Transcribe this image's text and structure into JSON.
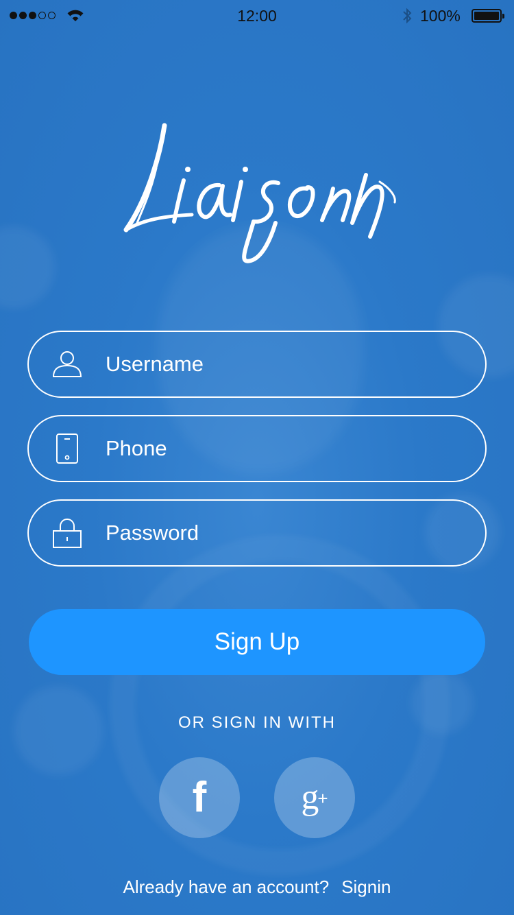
{
  "status_bar": {
    "time": "12:00",
    "battery_percent": "100%",
    "signal_dots_filled": 3,
    "signal_dots_total": 5
  },
  "logo": {
    "text": "Liaison"
  },
  "form": {
    "username_placeholder": "Username",
    "phone_placeholder": "Phone",
    "password_placeholder": "Password",
    "submit_label": "Sign Up"
  },
  "social": {
    "heading": "OR SIGN IN WITH",
    "facebook_glyph": "f",
    "google_glyph": "g",
    "google_plus_glyph": "+"
  },
  "footer": {
    "prompt": "Already have an account?",
    "link_label": "Signin"
  },
  "colors": {
    "background": "#2a78c8",
    "button": "#1e95ff"
  },
  "icons": {
    "username": "user-icon",
    "phone": "phone-icon",
    "password": "lock-icon",
    "facebook": "facebook-icon",
    "google": "google-plus-icon"
  }
}
